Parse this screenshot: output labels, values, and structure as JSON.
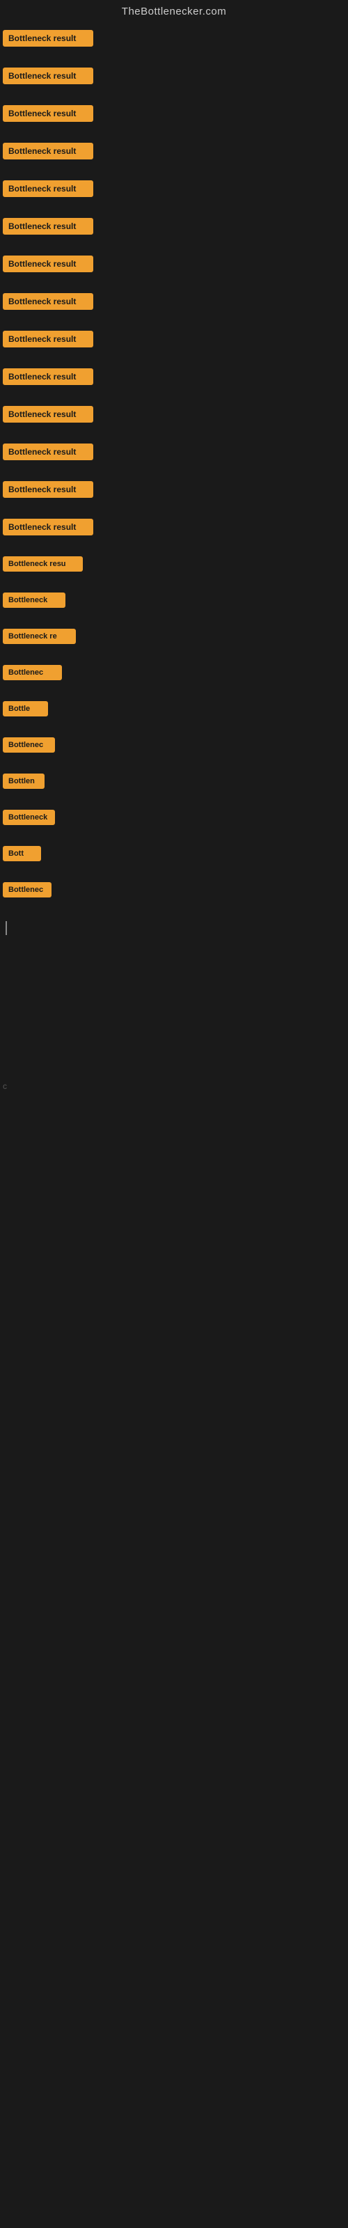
{
  "header": {
    "title": "TheBottlenecker.com"
  },
  "items": [
    {
      "id": 1,
      "label": "Bottleneck result"
    },
    {
      "id": 2,
      "label": "Bottleneck result"
    },
    {
      "id": 3,
      "label": "Bottleneck result"
    },
    {
      "id": 4,
      "label": "Bottleneck result"
    },
    {
      "id": 5,
      "label": "Bottleneck result"
    },
    {
      "id": 6,
      "label": "Bottleneck result"
    },
    {
      "id": 7,
      "label": "Bottleneck result"
    },
    {
      "id": 8,
      "label": "Bottleneck result"
    },
    {
      "id": 9,
      "label": "Bottleneck result"
    },
    {
      "id": 10,
      "label": "Bottleneck result"
    },
    {
      "id": 11,
      "label": "Bottleneck result"
    },
    {
      "id": 12,
      "label": "Bottleneck result"
    },
    {
      "id": 13,
      "label": "Bottleneck result"
    },
    {
      "id": 14,
      "label": "Bottleneck result"
    },
    {
      "id": 15,
      "label": "Bottleneck resu"
    },
    {
      "id": 16,
      "label": "Bottleneck"
    },
    {
      "id": 17,
      "label": "Bottleneck re"
    },
    {
      "id": 18,
      "label": "Bottlenec"
    },
    {
      "id": 19,
      "label": "Bottle"
    },
    {
      "id": 20,
      "label": "Bottlenec"
    },
    {
      "id": 21,
      "label": "Bottlen"
    },
    {
      "id": 22,
      "label": "Bottleneck"
    },
    {
      "id": 23,
      "label": "Bott"
    },
    {
      "id": 24,
      "label": "Bottlenec"
    }
  ],
  "bottom_char": "c"
}
